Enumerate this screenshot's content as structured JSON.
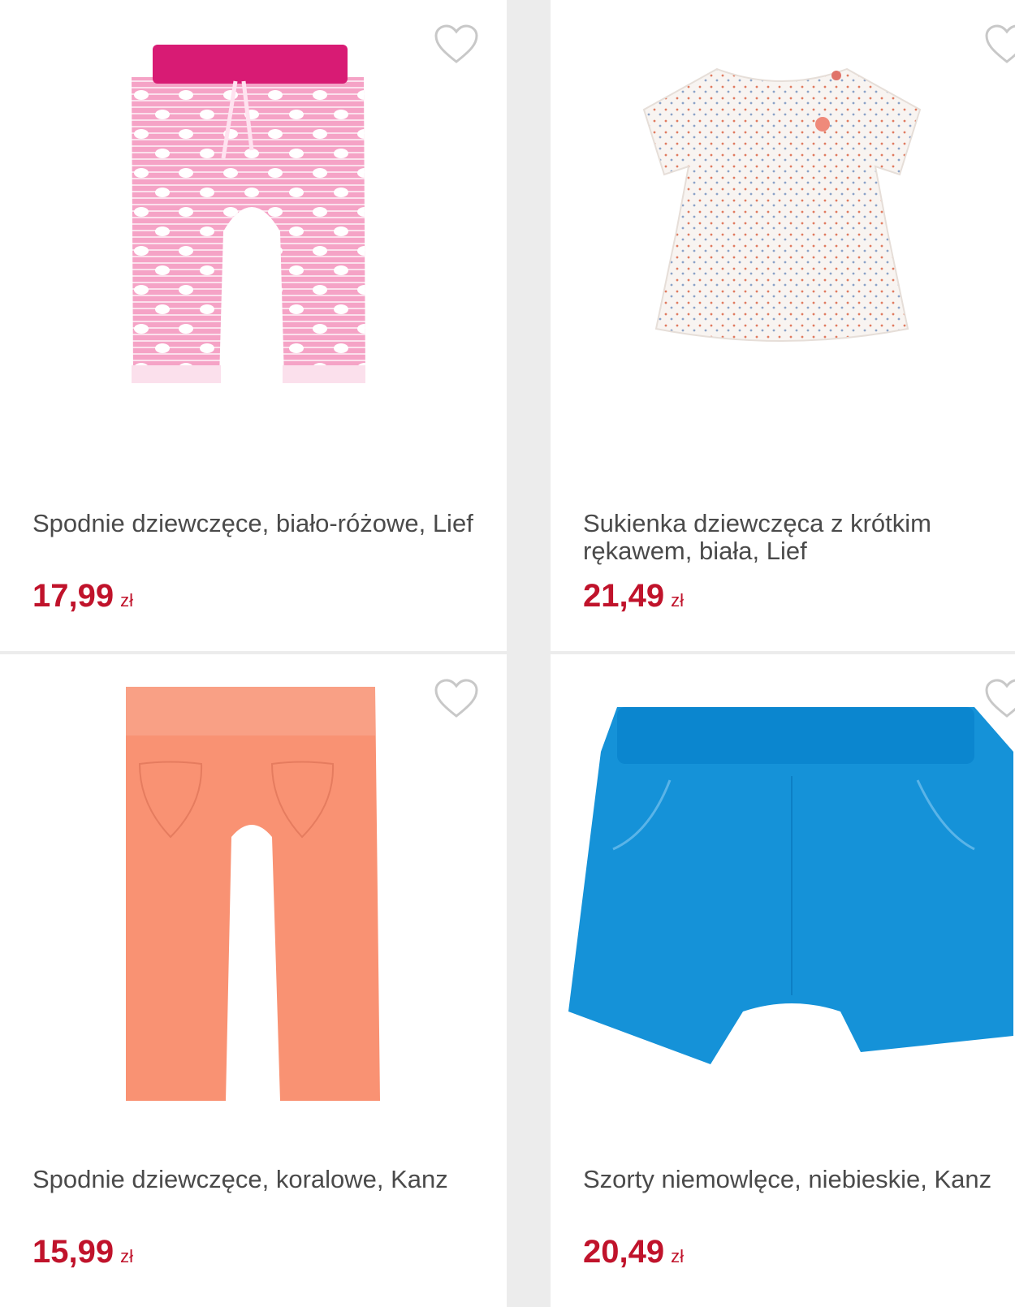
{
  "products": [
    {
      "title": "Spodnie dziewczęce, biało-różowe, Lief",
      "price": "17,99",
      "currency": "zł",
      "image": "pink-striped-pants"
    },
    {
      "title": "Sukienka dziewczęca z krótkim rękawem, biała, Lief",
      "price": "21,49",
      "currency": "zł",
      "image": "white-dotted-dress"
    },
    {
      "title": "Spodnie dziewczęce, koralowe, Kanz",
      "price": "15,99",
      "currency": "zł",
      "image": "coral-pants"
    },
    {
      "title": "Szorty niemowlęce, niebieskie, Kanz",
      "price": "20,49",
      "currency": "zł",
      "image": "blue-shorts"
    }
  ],
  "colors": {
    "price": "#c0132b",
    "title": "#4a4a4a",
    "heart": "#c8c8c8",
    "background": "#ececec"
  },
  "icons": {
    "wishlist": "heart-outline-icon"
  }
}
